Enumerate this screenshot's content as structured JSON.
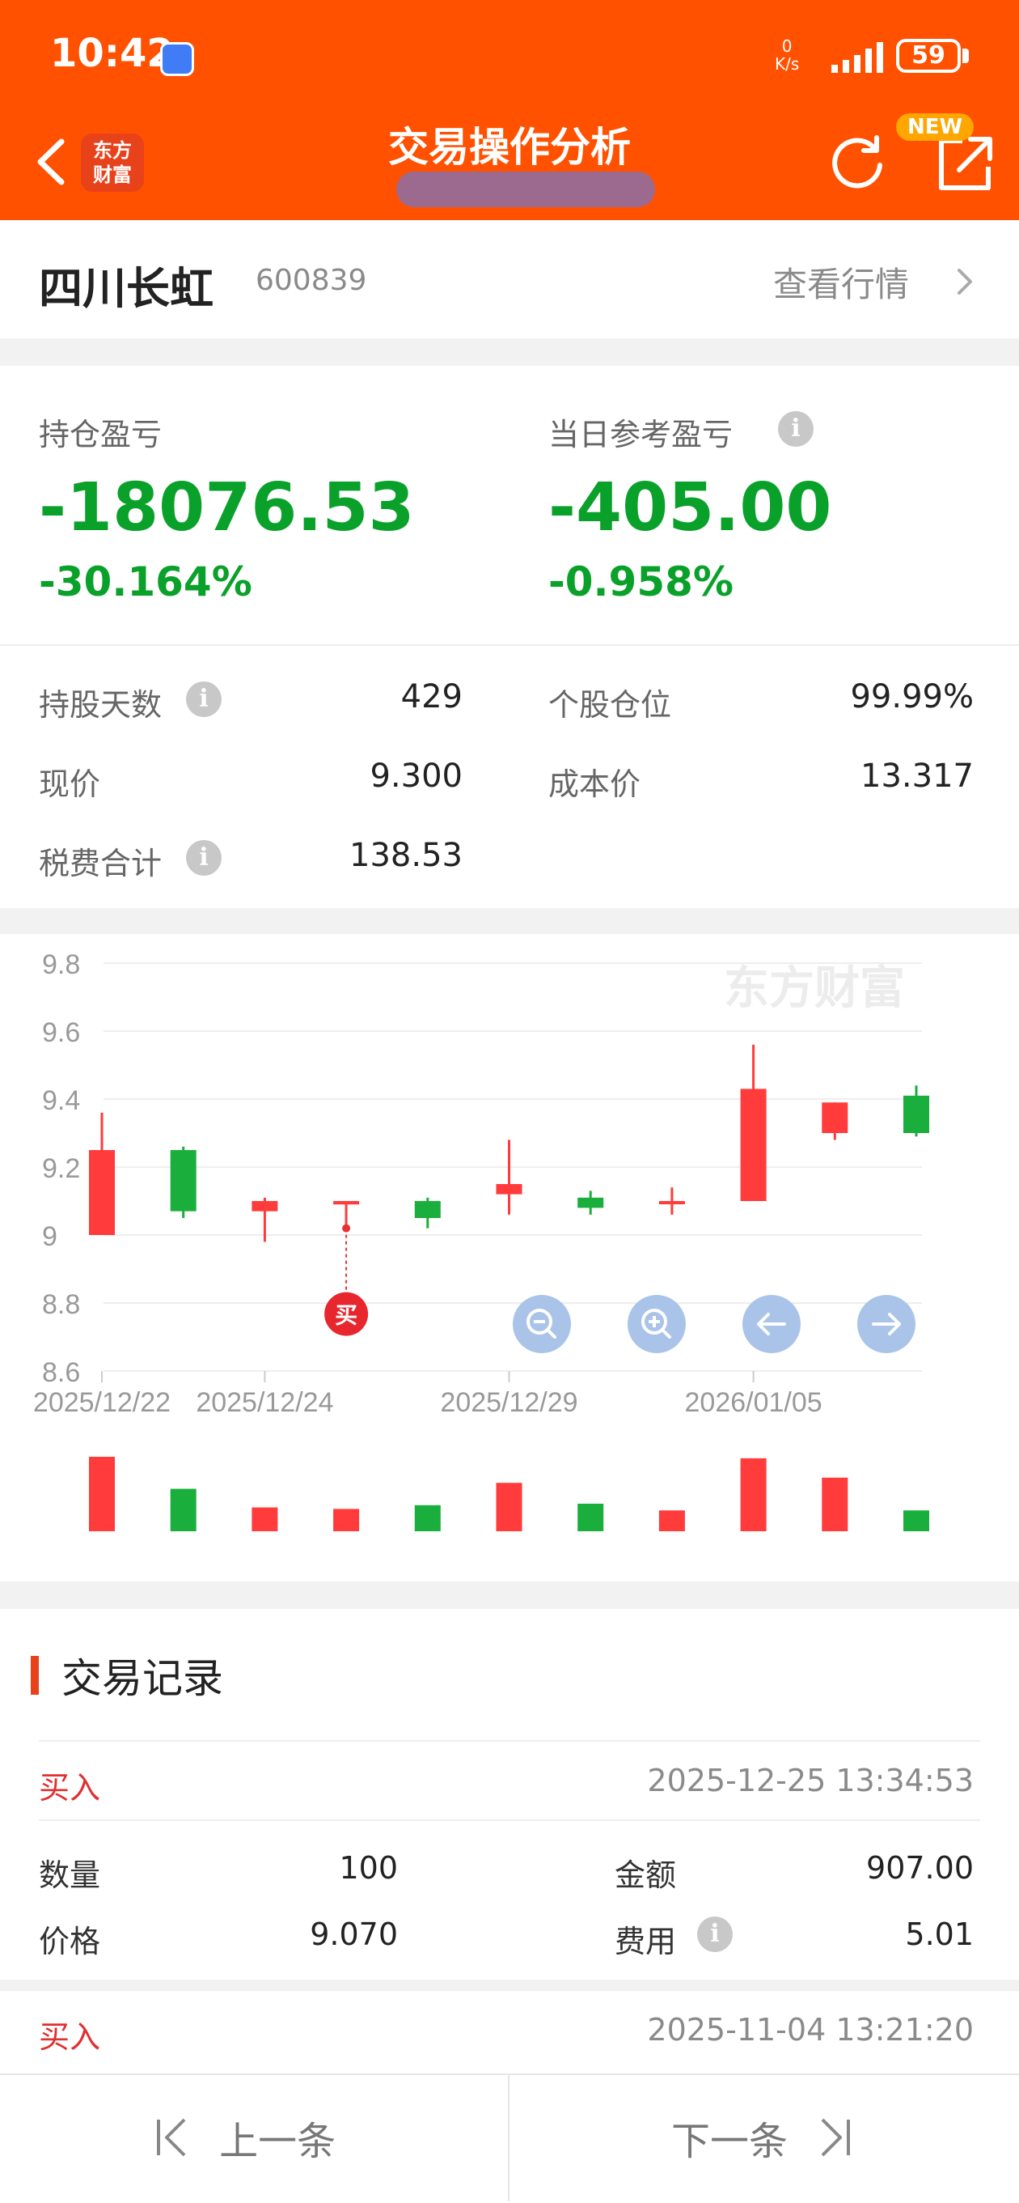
{
  "status_bar": {
    "time": "10:42",
    "net_speed_value": "0",
    "net_speed_unit": "K/s",
    "battery": "59"
  },
  "header": {
    "title": "交易操作分析",
    "logo_text": "东方财富",
    "new_badge": "NEW"
  },
  "stock": {
    "name": "四川长虹",
    "code": "600839",
    "view_quote": "查看行情"
  },
  "pl": {
    "position_label": "持仓盈亏",
    "position_value": "-18076.53",
    "position_pct": "-30.164%",
    "daily_label": "当日参考盈亏",
    "daily_value": "-405.00",
    "daily_pct": "-0.958%"
  },
  "stats": {
    "days_label": "持股天数",
    "days_value": "429",
    "weight_label": "个股仓位",
    "weight_value": "99.99%",
    "price_label": "现价",
    "price_value": "9.300",
    "cost_label": "成本价",
    "cost_value": "13.317",
    "fee_label": "税费合计",
    "fee_value": "138.53"
  },
  "chart_data": {
    "type": "candlestick",
    "watermark": "东方财富",
    "y_ticks": [
      "9.8",
      "9.6",
      "9.4",
      "9.2",
      "9",
      "8.8",
      "8.6"
    ],
    "ylim": [
      8.6,
      9.8
    ],
    "x_tick_labels": [
      {
        "index": 0,
        "label": "2025/12/22"
      },
      {
        "index": 2,
        "label": "2025/12/24"
      },
      {
        "index": 5,
        "label": "2025/12/29"
      },
      {
        "index": 8,
        "label": "2026/01/05"
      }
    ],
    "candles": [
      {
        "open": 9.0,
        "close": 9.25,
        "high": 9.36,
        "low": 9.0
      },
      {
        "open": 9.25,
        "close": 9.07,
        "high": 9.26,
        "low": 9.05
      },
      {
        "open": 9.07,
        "close": 9.1,
        "high": 9.11,
        "low": 8.98
      },
      {
        "open": 9.09,
        "close": 9.1,
        "high": 9.1,
        "low": 9.03
      },
      {
        "open": 9.1,
        "close": 9.05,
        "high": 9.11,
        "low": 9.02
      },
      {
        "open": 9.12,
        "close": 9.15,
        "high": 9.28,
        "low": 9.06
      },
      {
        "open": 9.11,
        "close": 9.08,
        "high": 9.13,
        "low": 9.06
      },
      {
        "open": 9.1,
        "close": 9.1,
        "high": 9.14,
        "low": 9.06
      },
      {
        "open": 9.1,
        "close": 9.43,
        "high": 9.56,
        "low": 9.1
      },
      {
        "open": 9.3,
        "close": 9.39,
        "high": 9.39,
        "low": 9.28
      },
      {
        "open": 9.41,
        "close": 9.3,
        "high": 9.44,
        "low": 9.29
      }
    ],
    "volume_relative": [
      1.0,
      0.57,
      0.32,
      0.3,
      0.35,
      0.65,
      0.37,
      0.28,
      0.98,
      0.72,
      0.28
    ],
    "buy_marker": {
      "index": 3,
      "label": "买",
      "price": 9.02
    },
    "colors": {
      "up": "#ff3b3b",
      "down": "#1aaf3c",
      "grid": "#eeeeee",
      "axis_text": "#999999"
    }
  },
  "chart_controls": {
    "zoom_out": "zoom-out",
    "zoom_in": "zoom-in",
    "prev": "left",
    "next": "right"
  },
  "records": {
    "title": "交易记录",
    "items": [
      {
        "type": "买入",
        "time": "2025-12-25 13:34:53",
        "qty_label": "数量",
        "qty": "100",
        "amount_label": "金额",
        "amount": "907.00",
        "price_label": "价格",
        "price": "9.070",
        "fee_label": "费用",
        "fee": "5.01"
      },
      {
        "type": "买入",
        "time": "2025-11-04 13:21:20"
      }
    ]
  },
  "bottom_nav": {
    "prev": "上一条",
    "next": "下一条"
  }
}
